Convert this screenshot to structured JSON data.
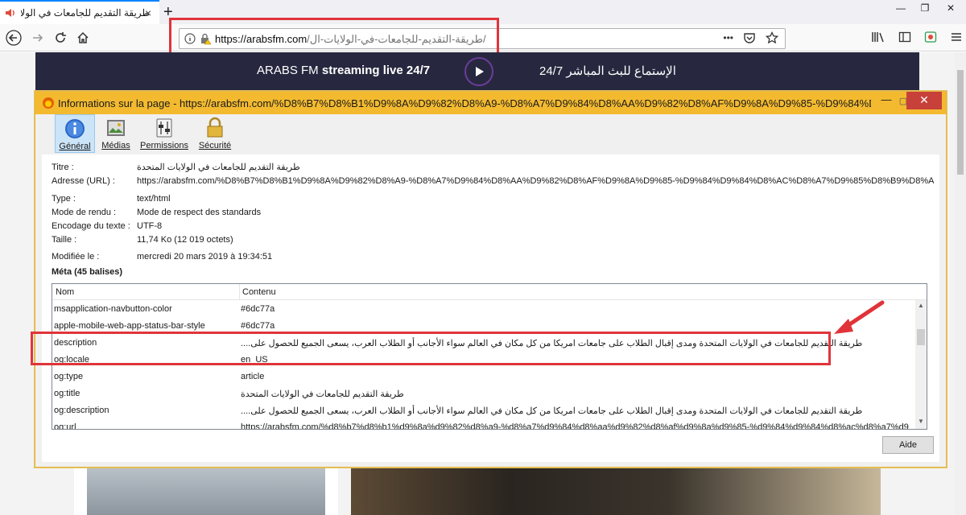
{
  "browser": {
    "tab_title": "طريقة التقديم للجامعات في الولا",
    "tab_close": "×",
    "new_tab": "+",
    "url_domain": "https://arabsfm.com",
    "url_path": "/طريقة-التقديم-للجامعات-في-الولايات-ال/",
    "url_dots": "•••",
    "win_min": "—",
    "win_max": "❐",
    "win_close": "✕"
  },
  "banner": {
    "left_normal": "ARABS FM ",
    "left_bold": "streaming live 24/7",
    "right_text": "الإستماع للبث المباشر 24/7"
  },
  "dialog": {
    "title": "Informations sur la page - https://arabsfm.com/%D8%B7%D8%B1%D9%8A%D9%82%D8%A9-%D8%A7%D9%84%D8%AA%D9%82%D8%AF%D9%8A%D9%85-%D9%84%D8...",
    "min": "—",
    "max": "▢",
    "close": "✕",
    "tabs": [
      {
        "label": "Général",
        "icon": "info-icon"
      },
      {
        "label": "Médias",
        "icon": "media-icon"
      },
      {
        "label": "Permissions",
        "icon": "permissions-icon"
      },
      {
        "label": "Sécurité",
        "icon": "lock-icon"
      }
    ],
    "fields": {
      "titre_label": "Titre :",
      "titre_value": "طريقة التقديم للجامعات في الولايات المتحدة",
      "adresse_label": "Adresse (URL) :",
      "adresse_value": "https://arabsfm.com/%D8%B7%D8%B1%D9%8A%D9%82%D8%A9-%D8%A7%D9%84%D8%AA%D9%82%D8%AF%D9%8A%D9%85-%D9%84%D9%84%D8%AC%D8%A7%D9%85%D8%B9%D8%A7%D8%AA-%D9%8",
      "type_label": "Type :",
      "type_value": "text/html",
      "rendu_label": "Mode de rendu :",
      "rendu_value": "Mode de respect des standards",
      "encodage_label": "Encodage du texte :",
      "encodage_value": "UTF-8",
      "taille_label": "Taille :",
      "taille_value": "11,74 Ko (12 019 octets)",
      "modifiee_label": "Modifiée le :",
      "modifiee_value": "mercredi 20 mars 2019 à 19:34:51"
    },
    "meta_heading": "Méta (45 balises)",
    "meta_columns": {
      "nom": "Nom",
      "contenu": "Contenu"
    },
    "meta_rows": [
      {
        "k": "msapplication-navbutton-color",
        "v": "#6dc77a"
      },
      {
        "k": "apple-mobile-web-app-status-bar-style",
        "v": "#6dc77a"
      },
      {
        "k": "description",
        "v": "طريقة التقديم للجامعات في الولايات المتحدة ومدى إقبال الطلاب على جامعات امريكا من كل مكان في العالم سواء الأجانب أو الطلاب العرب، يسعى الجميع للحصول على...."
      },
      {
        "k": "og:locale",
        "v": "en_US"
      },
      {
        "k": "og:type",
        "v": "article"
      },
      {
        "k": "og:title",
        "v": "طريقة التقديم للجامعات في الولايات المتحدة"
      },
      {
        "k": "og:description",
        "v": "طريقة التقديم للجامعات في الولايات المتحدة ومدى إقبال الطلاب على جامعات امريكا من كل مكان في العالم سواء الأجانب أو الطلاب العرب، يسعى الجميع للحصول على...."
      },
      {
        "k": "og:url",
        "v": "https://arabsfm.com/%d8%b7%d8%b1%d9%8a%d9%82%d8%a9-%d8%a7%d9%84%d8%aa%d9%82%d8%af%d9%8a%d9%85-%d9%84%d9%84%d8%ac%d8%a7%d9%85%d8%b9%d8%a7%d8%aa-%d9%81%d9%8a-%d8"
      }
    ],
    "aide_label": "Aide"
  },
  "colors": {
    "dialog_title_bg": "#f3ba30",
    "close_red": "#c7413a",
    "annotation_red": "#e0343a",
    "banner_bg": "#27283f",
    "accent_tab": "#0a84ff"
  }
}
